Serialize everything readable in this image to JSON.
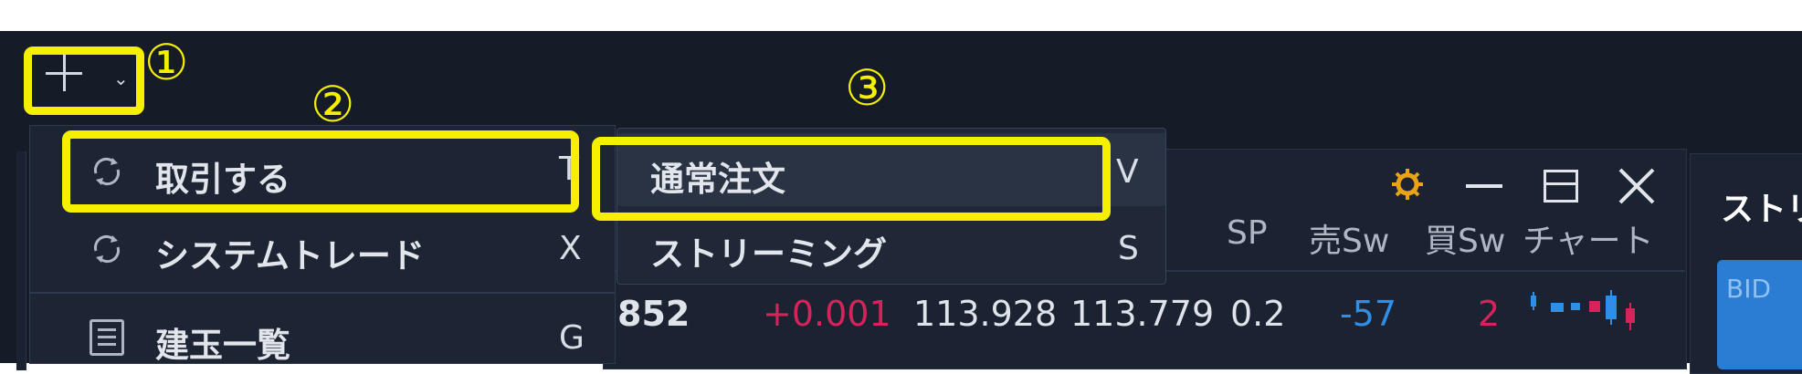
{
  "callouts": [
    "①",
    "②",
    "③"
  ],
  "toolbar": {
    "add_icon": "plus-icon",
    "caret_icon": "chevron-down-icon"
  },
  "dropdown": {
    "items": [
      {
        "label": "取引する",
        "shortcut": "T",
        "icon": "sync-icon"
      },
      {
        "label": "システムトレード",
        "shortcut": "X",
        "icon": "sync-icon"
      },
      {
        "label": "建玉一覧",
        "shortcut": "G",
        "icon": "list-icon"
      }
    ]
  },
  "submenu": {
    "items": [
      {
        "label": "通常注文",
        "shortcut": "V"
      },
      {
        "label": "ストリーミング",
        "shortcut": "S"
      }
    ]
  },
  "rate_panel": {
    "headers": [
      "SP",
      "売Sw",
      "買Sw",
      "チャート"
    ],
    "row": {
      "pair_suffix": "852",
      "change": "+0.001",
      "bid": "113.928",
      "ask": "113.779",
      "sp": "0.2",
      "sell_sw": "-57",
      "buy_sw": "2"
    },
    "window_icons": [
      "gear-icon",
      "minimize-icon",
      "maximize-icon",
      "close-icon"
    ]
  },
  "stream_panel": {
    "title": "ストリ",
    "bid_label": "BID"
  },
  "colors": {
    "highlight": "#f4f000",
    "positive": "#d6245b",
    "negative": "#2f8ee8",
    "background": "#161c27"
  }
}
